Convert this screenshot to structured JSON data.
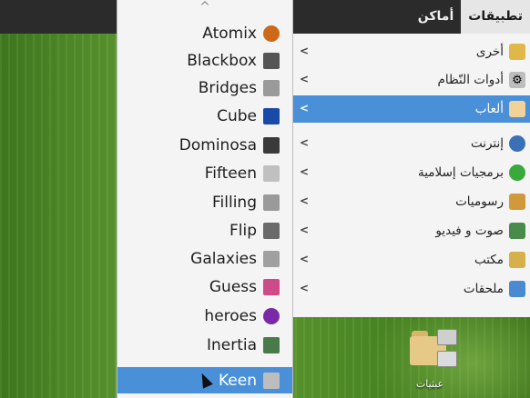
{
  "panel": {
    "applications": "تطبيقات",
    "places": "أماكن"
  },
  "main_menu": {
    "items": [
      {
        "label": "أخرى",
        "icon": "other-icon",
        "color": "#e0b84a"
      },
      {
        "label": "أدوات النّظام",
        "icon": "system-tools-icon",
        "color": "#9a9a9a"
      },
      {
        "label": "ألعاب",
        "icon": "games-icon",
        "color": "#c88a3a"
      },
      {
        "label": "إنترنت",
        "icon": "internet-icon",
        "color": "#3b6fb6"
      },
      {
        "label": "برمجيات إسلامية",
        "icon": "islamic-software-icon",
        "color": "#3aa83a"
      },
      {
        "label": "رسوميات",
        "icon": "graphics-icon",
        "color": "#d09a3a"
      },
      {
        "label": "صوت و فيديو",
        "icon": "sound-video-icon",
        "color": "#4a8a4a"
      },
      {
        "label": "مكتب",
        "icon": "office-icon",
        "color": "#d6b04a"
      },
      {
        "label": "ملحقات",
        "icon": "accessories-icon",
        "color": "#4a8ad0"
      }
    ],
    "selected_index": 2
  },
  "games_menu": {
    "scroll_up": "^",
    "items": [
      {
        "label": "Atomix",
        "icon": "atomix-icon",
        "color": "#cc6a1a"
      },
      {
        "label": "Blackbox",
        "icon": "blackbox-icon",
        "color": "#555555"
      },
      {
        "label": "Bridges",
        "icon": "bridges-icon",
        "color": "#8a8a8a"
      },
      {
        "label": "Cube",
        "icon": "cube-icon",
        "color": "#1a4aa8"
      },
      {
        "label": "Dominosa",
        "icon": "dominosa-icon",
        "color": "#3a3a3a"
      },
      {
        "label": "Fifteen",
        "icon": "fifteen-icon",
        "color": "#b0b0b0"
      },
      {
        "label": "Filling",
        "icon": "filling-icon",
        "color": "#9a9a9a"
      },
      {
        "label": "Flip",
        "icon": "flip-icon",
        "color": "#6a6a6a"
      },
      {
        "label": "Galaxies",
        "icon": "galaxies-icon",
        "color": "#a0a0a0"
      },
      {
        "label": "Guess",
        "icon": "guess-icon",
        "color": "#d04a8a"
      },
      {
        "label": "heroes",
        "icon": "heroes-icon",
        "color": "#7a2aa8"
      },
      {
        "label": "Inertia",
        "icon": "inertia-icon",
        "color": "#4a7a4a"
      },
      {
        "label": "Keen",
        "icon": "keen-icon",
        "color": "#8a8a8a"
      }
    ],
    "selected_index": 12
  },
  "desktop": {
    "folder_label": "عبثيات"
  }
}
